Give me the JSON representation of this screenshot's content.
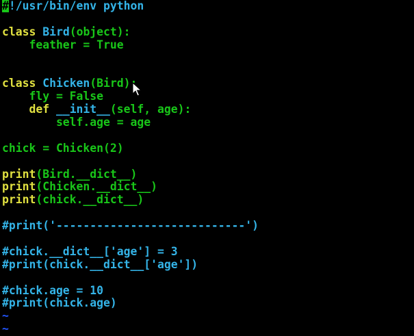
{
  "editor": {
    "lines": [
      {
        "segments": [
          {
            "t": "#",
            "c": "cursor-block"
          },
          {
            "t": "!/usr/bin/env python",
            "c": "com"
          }
        ]
      },
      {
        "segments": []
      },
      {
        "segments": [
          {
            "t": "class ",
            "c": "kw"
          },
          {
            "t": "Bird",
            "c": "cls"
          },
          {
            "t": "(object):",
            "c": "def"
          }
        ]
      },
      {
        "segments": [
          {
            "t": "    feather = True",
            "c": "def"
          }
        ]
      },
      {
        "segments": []
      },
      {
        "segments": []
      },
      {
        "segments": [
          {
            "t": "class ",
            "c": "kw"
          },
          {
            "t": "Chicken",
            "c": "cls"
          },
          {
            "t": "(Bird):",
            "c": "def"
          }
        ]
      },
      {
        "segments": [
          {
            "t": "    fly = False",
            "c": "def"
          }
        ]
      },
      {
        "segments": [
          {
            "t": "    def ",
            "c": "kw"
          },
          {
            "t": "__init__",
            "c": "cls"
          },
          {
            "t": "(self, age):",
            "c": "def"
          }
        ]
      },
      {
        "segments": [
          {
            "t": "        self.age = age",
            "c": "def"
          }
        ]
      },
      {
        "segments": []
      },
      {
        "segments": [
          {
            "t": "chick = Chicken(2)",
            "c": "def"
          }
        ]
      },
      {
        "segments": []
      },
      {
        "segments": [
          {
            "t": "print",
            "c": "kw"
          },
          {
            "t": "(Bird.__dict__)",
            "c": "def"
          }
        ]
      },
      {
        "segments": [
          {
            "t": "print",
            "c": "kw"
          },
          {
            "t": "(Chicken.__dict__)",
            "c": "def"
          }
        ]
      },
      {
        "segments": [
          {
            "t": "print",
            "c": "kw"
          },
          {
            "t": "(chick.__dict__)",
            "c": "def"
          }
        ]
      },
      {
        "segments": []
      },
      {
        "segments": [
          {
            "t": "#print('----------------------------')",
            "c": "com"
          }
        ]
      },
      {
        "segments": []
      },
      {
        "segments": [
          {
            "t": "#chick.__dict__['age'] = 3",
            "c": "com"
          }
        ]
      },
      {
        "segments": [
          {
            "t": "#print(chick.__dict__['age'])",
            "c": "com"
          }
        ]
      },
      {
        "segments": []
      },
      {
        "segments": [
          {
            "t": "#chick.age = 10",
            "c": "com"
          }
        ]
      },
      {
        "segments": [
          {
            "t": "#print(chick.age)",
            "c": "com"
          }
        ]
      },
      {
        "segments": [
          {
            "t": "~",
            "c": "tilde"
          }
        ]
      },
      {
        "segments": [
          {
            "t": "~",
            "c": "tilde"
          }
        ]
      }
    ]
  },
  "colors": {
    "background": "#000000",
    "keyword": "#e0e040",
    "identifier": "#34b4e8",
    "comment": "#34b4e8",
    "default": "#19c619",
    "tilde": "#2255ff"
  },
  "icons": {
    "mouse_pointer": "arrow-cursor-icon"
  }
}
